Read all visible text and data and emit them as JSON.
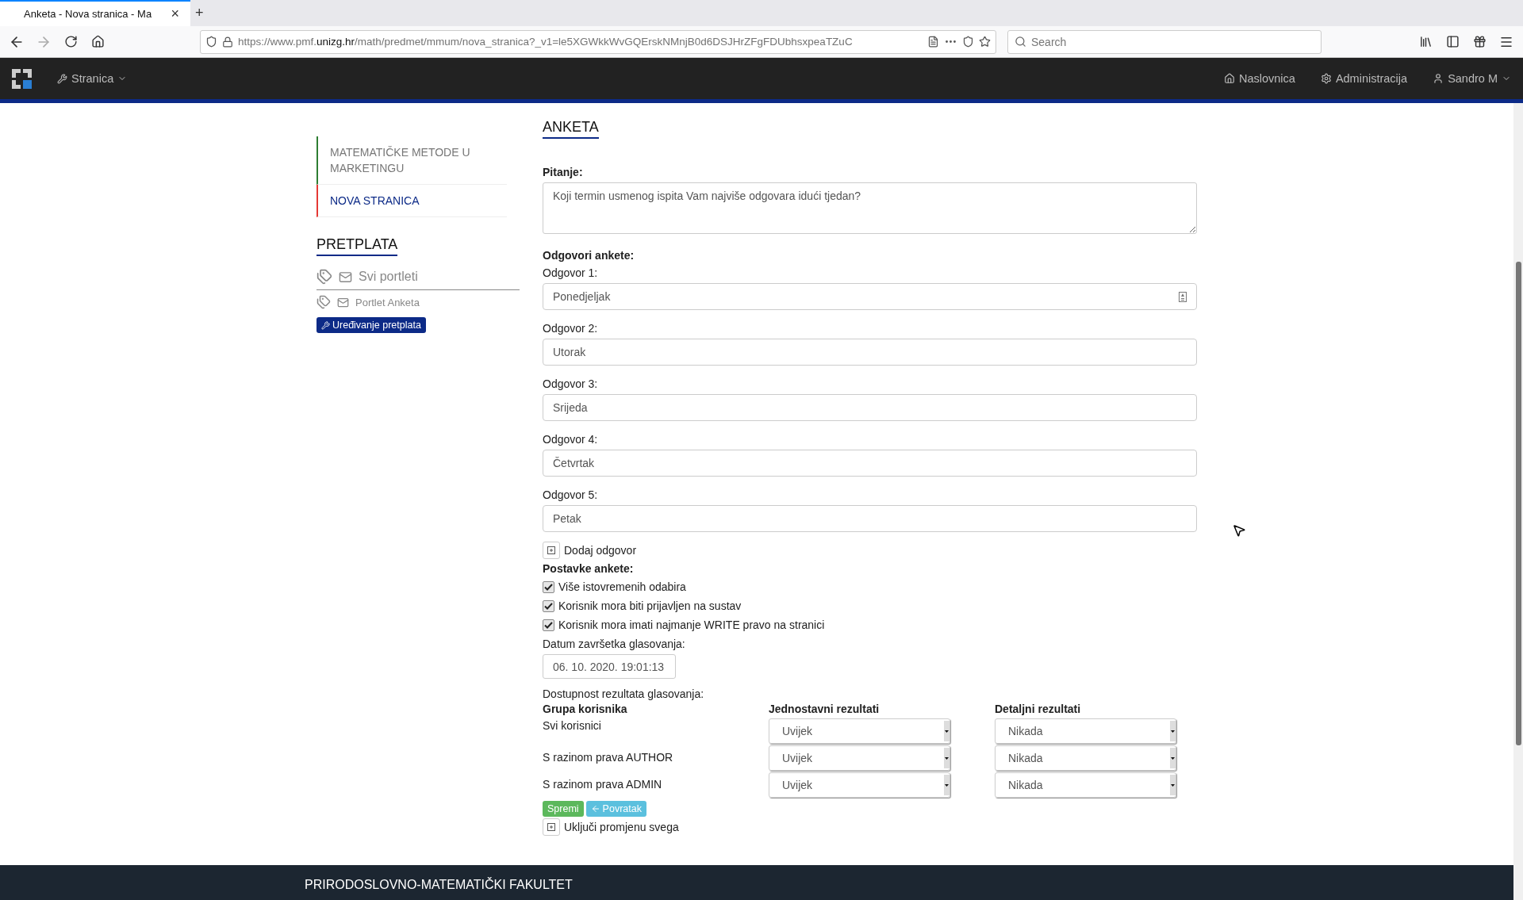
{
  "browser": {
    "tab_title": "Anketa - Nova stranica - Ma",
    "tab_close": "×",
    "new_tab": "+",
    "url": "https://www.pmf.**unizg.hr**/math/predmet/mmum/nova_stranica?_v1=le5XGWkkWvGQErskNMnjB0d6DSJHrZFgFDUbhsxpeaTZuC",
    "search_placeholder": "Search"
  },
  "navbar": {
    "menu": "Stranica",
    "links": [
      "Naslovnica",
      "Administracija",
      "Sandro M"
    ]
  },
  "sidebar": {
    "pages": [
      {
        "label": "MATEMATIČKE METODE U MARKETINGU",
        "selected": false,
        "color": "#2e7d32"
      },
      {
        "label": "NOVA STRANICA",
        "selected": true,
        "color": "#e53935"
      }
    ],
    "subscription_title": "PRETPLATA",
    "subscriptions": [
      {
        "label": "Svi portleti",
        "kind": "all"
      },
      {
        "label": "Portlet Anketa",
        "kind": "item"
      }
    ],
    "edit_button": "Uređivanje pretplata"
  },
  "form": {
    "title": "ANKETA",
    "question_label": "Pitanje:",
    "question": "Koji termin usmenog ispita Vam najviše odgovara idući tjedan?",
    "answers_label": "Odgovori ankete:",
    "answers": [
      {
        "label": "Odgovor 1:",
        "value": "Ponedjeljak",
        "autofill_icon": true
      },
      {
        "label": "Odgovor 2:",
        "value": "Utorak",
        "autofill_icon": false
      },
      {
        "label": "Odgovor 3:",
        "value": "Srijeda",
        "autofill_icon": false
      },
      {
        "label": "Odgovor 4:",
        "value": "Četvrtak",
        "autofill_icon": false
      },
      {
        "label": "Odgovor 5:",
        "value": "Petak",
        "autofill_icon": false
      }
    ],
    "add_answer": "Dodaj odgovor",
    "settings_label": "Postavke ankete:",
    "options": [
      {
        "label": "Više istovremenih odabira",
        "checked": true
      },
      {
        "label": "Korisnik mora biti prijavljen na sustav",
        "checked": true
      },
      {
        "label": "Korisnik mora imati najmanje WRITE pravo na stranici",
        "checked": true
      }
    ],
    "end_date_label": "Datum završetka glasovanja:",
    "end_date": "06. 10. 2020. 19:01:13",
    "availability_label": "Dostupnost rezultata glasovanja:",
    "columns": [
      "Grupa korisnika",
      "Jednostavni rezultati",
      "Detaljni rezultati"
    ],
    "rows": [
      {
        "group": "Svi korisnici",
        "simple": "Uvijek",
        "detailed": "Nikada"
      },
      {
        "group": "S razinom prava AUTHOR",
        "simple": "Uvijek",
        "detailed": "Nikada"
      },
      {
        "group": "S razinom prava ADMIN",
        "simple": "Uvijek",
        "detailed": "Nikada"
      }
    ],
    "save": "Spremi",
    "back": "Povratak",
    "toggle_all": "Uključi promjenu svega"
  },
  "footer": {
    "title": "PRIRODOSLOVNO-MATEMATIČKI FAKULTET"
  }
}
